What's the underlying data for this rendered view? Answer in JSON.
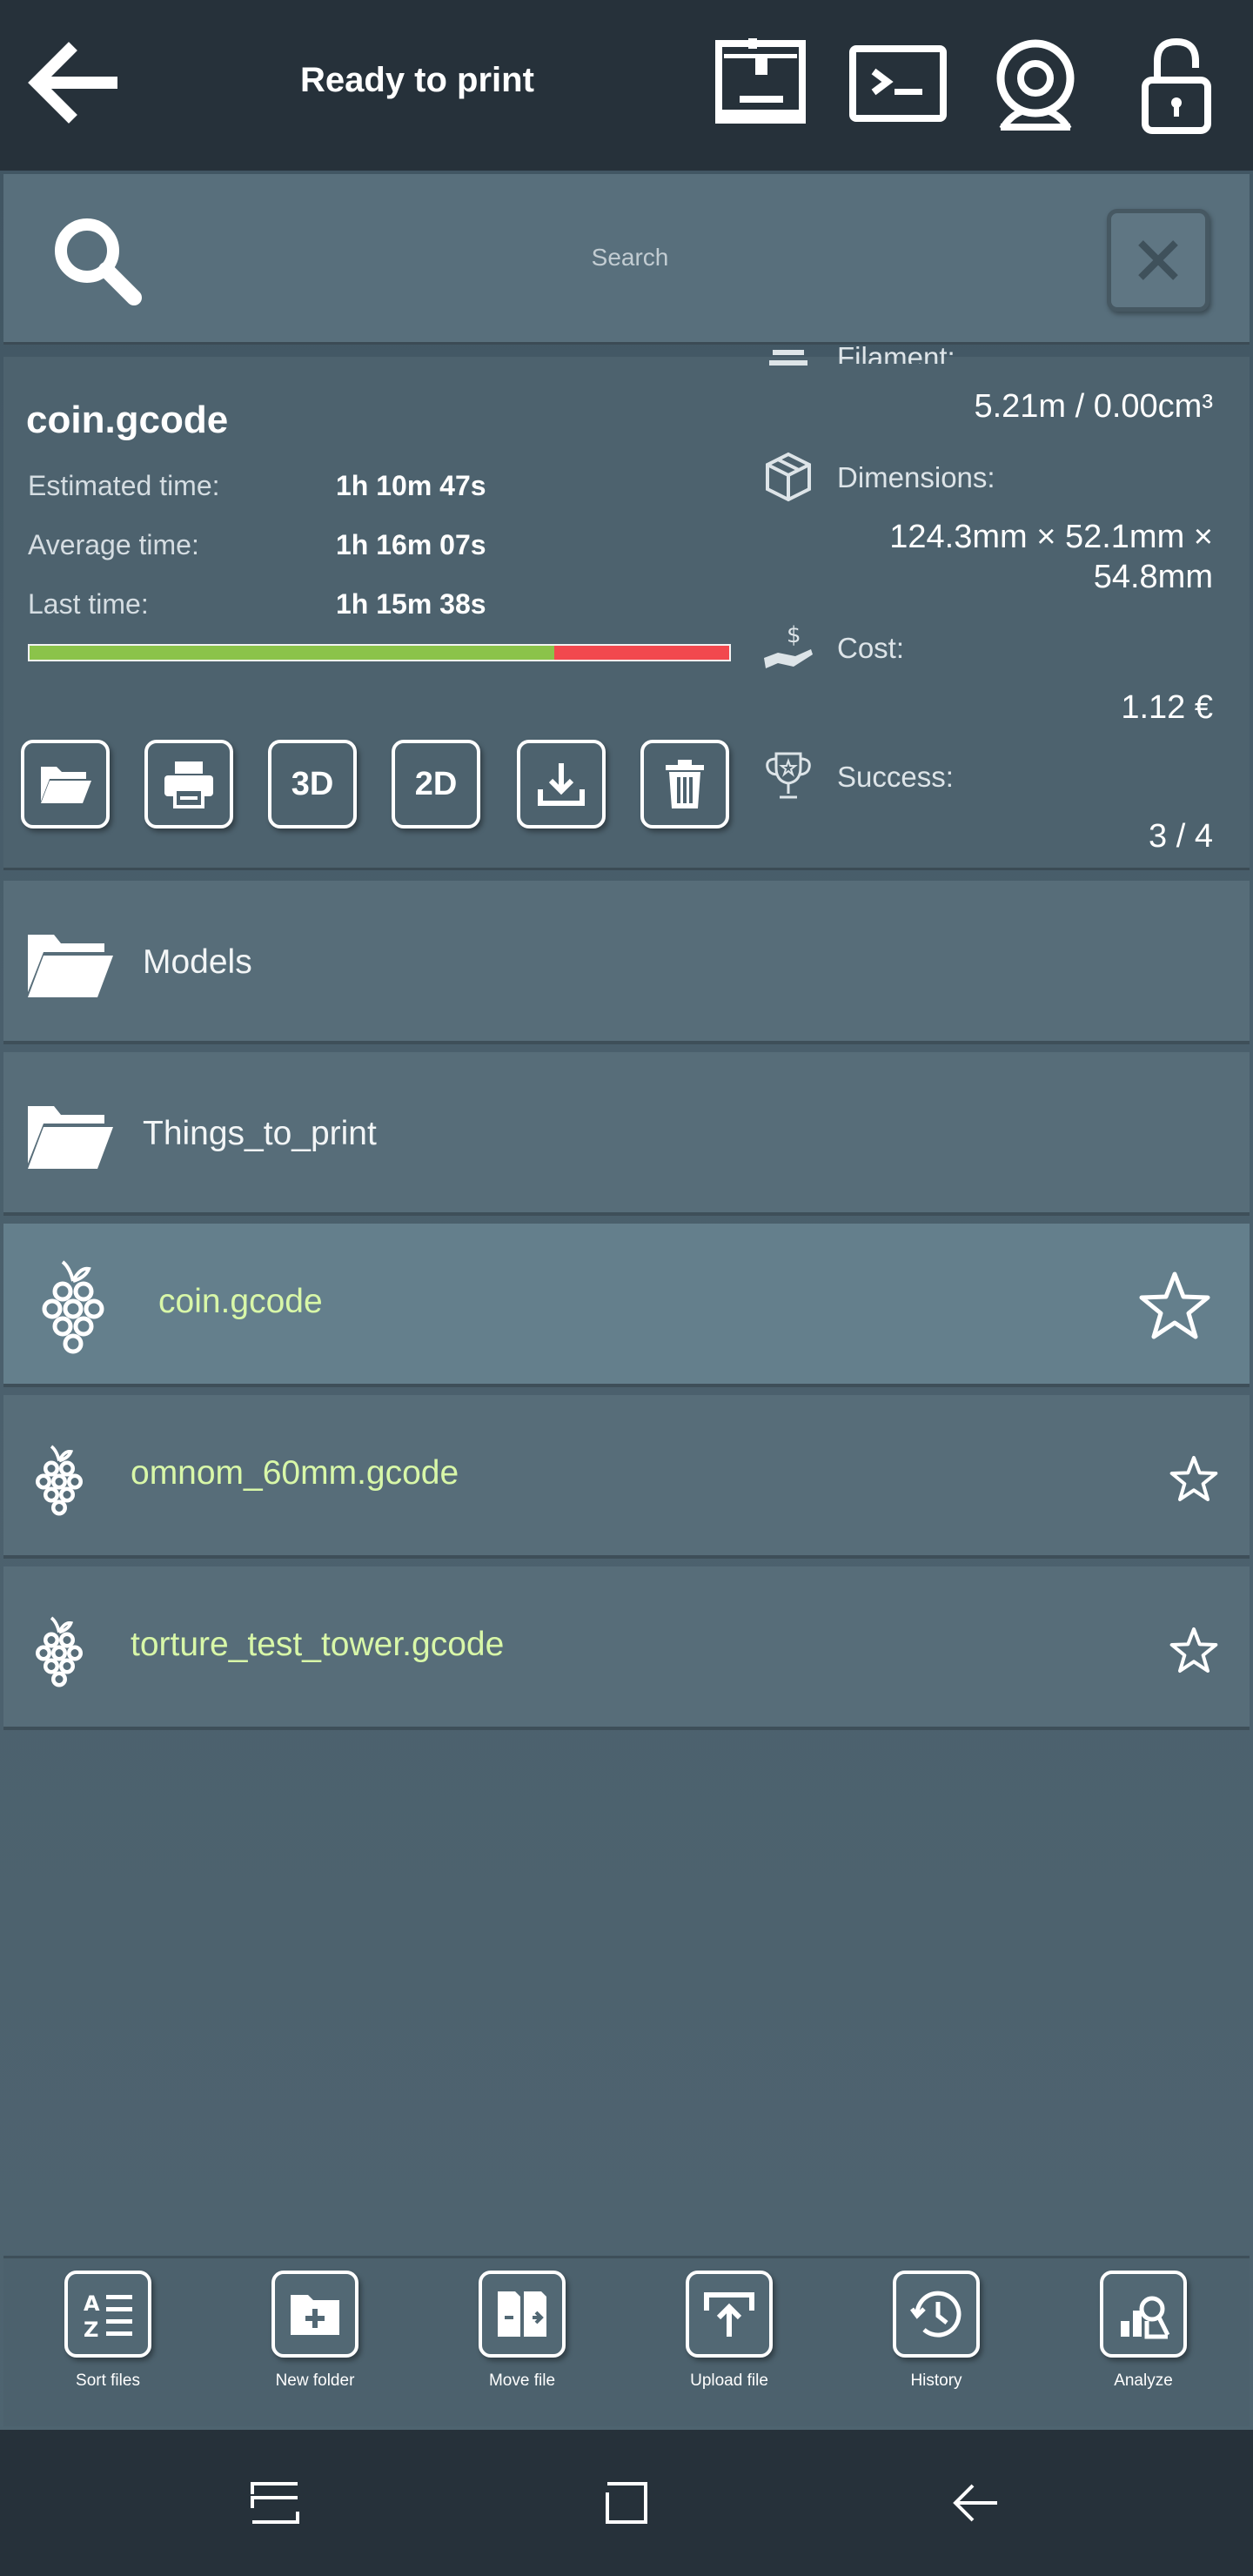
{
  "app": {
    "status_title": "Ready to print",
    "back_icon": "arrow-left-icon",
    "header_icons": [
      "printer-3d-icon",
      "terminal-icon",
      "webcam-icon",
      "lock-open-icon"
    ]
  },
  "search": {
    "placeholder": "Search",
    "icon": "search-icon",
    "clear_icon": "close-icon"
  },
  "details": {
    "file_name": "coin.gcode",
    "stats": [
      {
        "label": "Estimated time:",
        "value": "1h 10m 47s"
      },
      {
        "label": "Average time:",
        "value": "1h 16m 07s"
      },
      {
        "label": "Last time:",
        "value": "1h 15m 38s"
      }
    ],
    "success_ratio": 0.75,
    "actions": [
      {
        "name": "open-folder-button",
        "icon": "folder-open-icon",
        "label": ""
      },
      {
        "name": "print-button",
        "icon": "printer-icon",
        "label": ""
      },
      {
        "name": "view-3d-button",
        "icon": "",
        "label": "3D"
      },
      {
        "name": "view-2d-button",
        "icon": "",
        "label": "2D"
      },
      {
        "name": "download-button",
        "icon": "download-icon",
        "label": ""
      },
      {
        "name": "delete-button",
        "icon": "trash-icon",
        "label": ""
      }
    ],
    "filament_label": "Filament:",
    "filament_value": "5.21m / 0.00cm³",
    "dimensions_label": "Dimensions:",
    "dimensions_value_line1": "124.3mm × 52.1mm ×",
    "dimensions_value_line2": "54.8mm",
    "cost_label": "Cost:",
    "cost_value": "1.12 €",
    "success_label": "Success:",
    "success_value": "3 / 4"
  },
  "folders": [
    {
      "name": "Models",
      "icon": "folder-open-icon"
    },
    {
      "name": "Things_to_print",
      "icon": "folder-open-icon"
    }
  ],
  "files": [
    {
      "name": "coin.gcode",
      "icon": "grape-icon",
      "fav_icon": "star-outline-icon",
      "selected": true
    },
    {
      "name": "omnom_60mm.gcode",
      "icon": "grape-icon",
      "fav_icon": "star-outline-icon",
      "selected": false
    },
    {
      "name": "torture_test_tower.gcode",
      "icon": "grape-icon",
      "fav_icon": "star-outline-icon",
      "selected": false
    }
  ],
  "toolbar": [
    {
      "label": "Sort files",
      "icon": "sort-az-icon"
    },
    {
      "label": "New folder",
      "icon": "folder-plus-icon"
    },
    {
      "label": "Move file",
      "icon": "move-file-icon"
    },
    {
      "label": "Upload file",
      "icon": "upload-icon"
    },
    {
      "label": "History",
      "icon": "history-icon"
    },
    {
      "label": "Analyze",
      "icon": "analyze-icon"
    }
  ],
  "colors": {
    "topbar": "#26313a",
    "progress_good": "#8bc34a",
    "progress_bad": "#f2484e",
    "gcode_text": "#d8f7a8"
  }
}
